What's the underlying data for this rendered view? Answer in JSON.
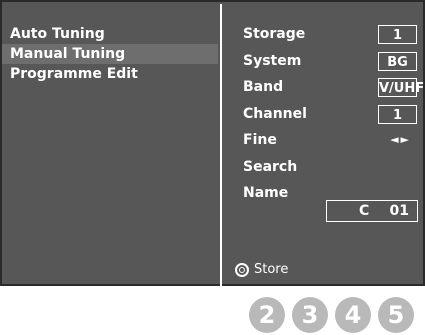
{
  "menu": {
    "items": [
      {
        "label": "Auto Tuning"
      },
      {
        "label": "Manual Tuning"
      },
      {
        "label": "Programme Edit"
      }
    ],
    "selected_index": 1
  },
  "settings": {
    "storage": {
      "label": "Storage",
      "value": "1"
    },
    "system": {
      "label": "System",
      "value": "BG"
    },
    "band": {
      "label": "Band",
      "value": "V/UHF"
    },
    "channel": {
      "label": "Channel",
      "value": "1"
    },
    "fine": {
      "label": "Fine",
      "value": "◄►"
    },
    "search": {
      "label": "Search"
    },
    "name": {
      "label": "Name",
      "value_letter": "C",
      "value_number": "01"
    }
  },
  "store": {
    "label": "Store",
    "icon": "ok-button-icon"
  },
  "keys": [
    "2",
    "3",
    "4",
    "5"
  ],
  "colors": {
    "screen_bg": "#575757",
    "selected_bg": "#6e6e6e",
    "key_bg": "#b9b9b9",
    "text": "#ffffff"
  }
}
